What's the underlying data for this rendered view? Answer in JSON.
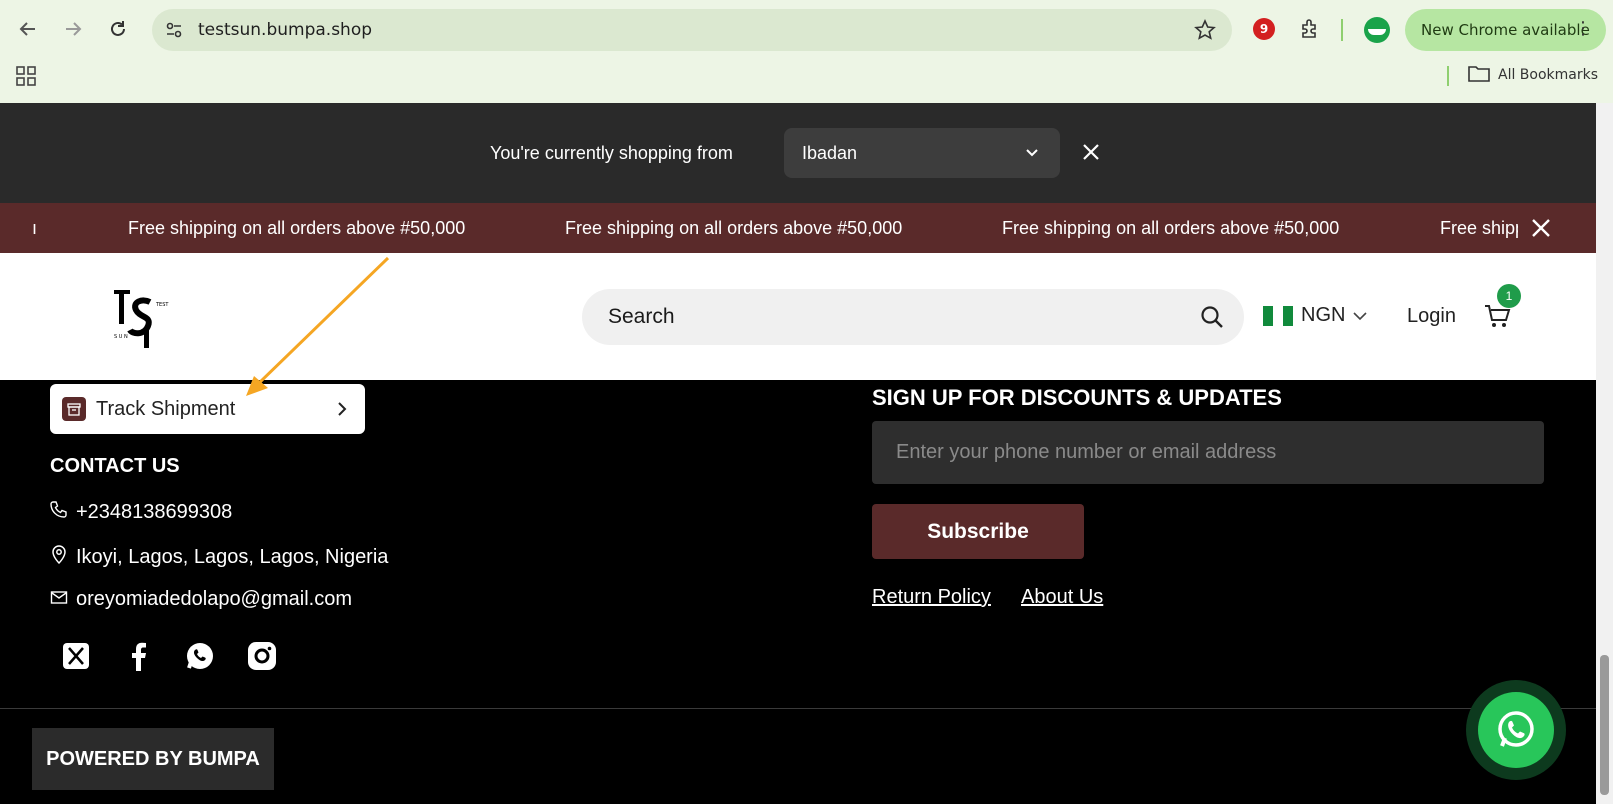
{
  "browser": {
    "url": "testsun.bumpa.shop",
    "update_label": "New Chrome available",
    "extension_badge": "9",
    "bookmarks_label": "All Bookmarks"
  },
  "location_bar": {
    "prompt": "You're currently shopping from",
    "selected_city": "Ibadan"
  },
  "promo": {
    "message": "Free shipping on all orders above #50,000",
    "partial": "Free shipp"
  },
  "header": {
    "search_placeholder": "Search",
    "currency": "NGN",
    "login_label": "Login",
    "cart_count": "1"
  },
  "footer": {
    "track_label": "Track Shipment",
    "contact_title": "CONTACT US",
    "phone": "+2348138699308",
    "address": "Ikoyi, Lagos, Lagos, Lagos, Nigeria",
    "email": "oreyomiadedolapo@gmail.com",
    "signup_title": "SIGN UP FOR DISCOUNTS & UPDATES",
    "signup_placeholder": "Enter your phone number or email address",
    "subscribe_label": "Subscribe",
    "links": [
      "Return Policy",
      "About Us"
    ],
    "powered_by": "POWERED BY BUMPA"
  },
  "colors": {
    "brand_maroon": "#5a2a2a",
    "whatsapp_green": "#28c65a",
    "badge_green": "#1f9c4a",
    "arrow_orange": "#f5a623"
  }
}
